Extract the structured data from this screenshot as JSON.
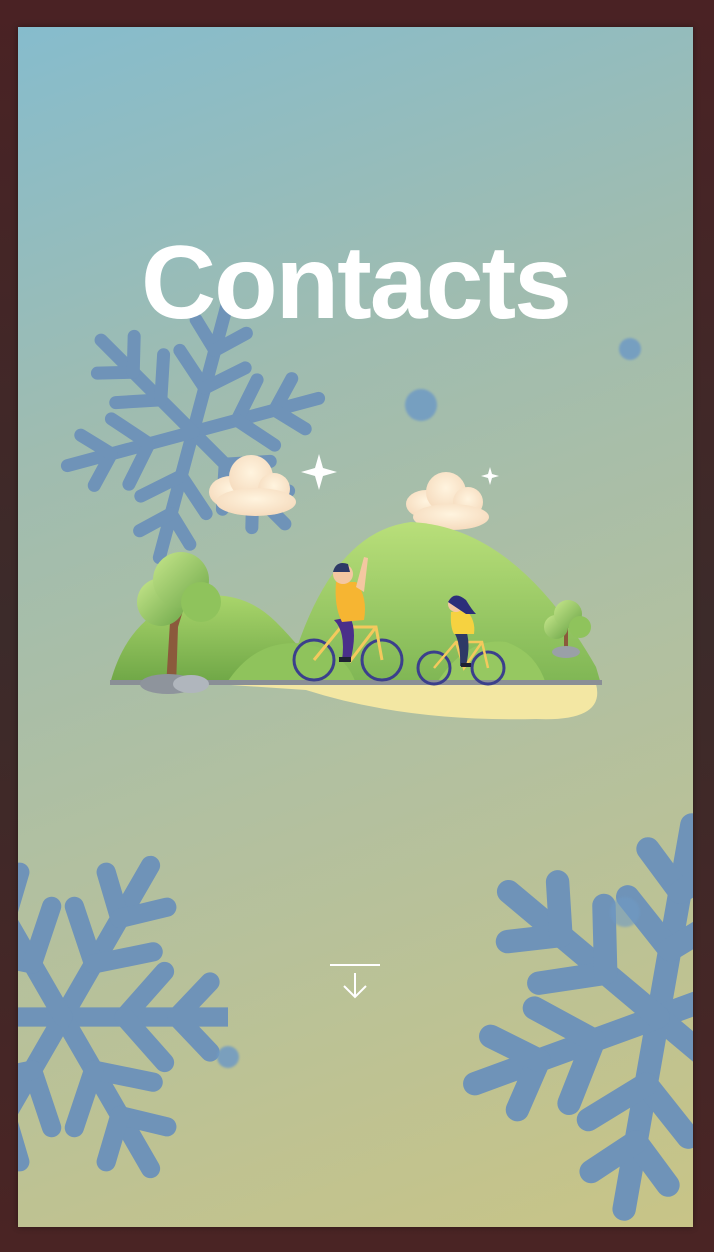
{
  "page": {
    "title": "Contacts"
  },
  "scroll_button": {
    "icon": "arrow-down-icon"
  },
  "colors": {
    "background_top": "#86bccd",
    "background_bottom": "#c8c487",
    "snowflake": "#6f93b8",
    "title": "#ffffff"
  }
}
